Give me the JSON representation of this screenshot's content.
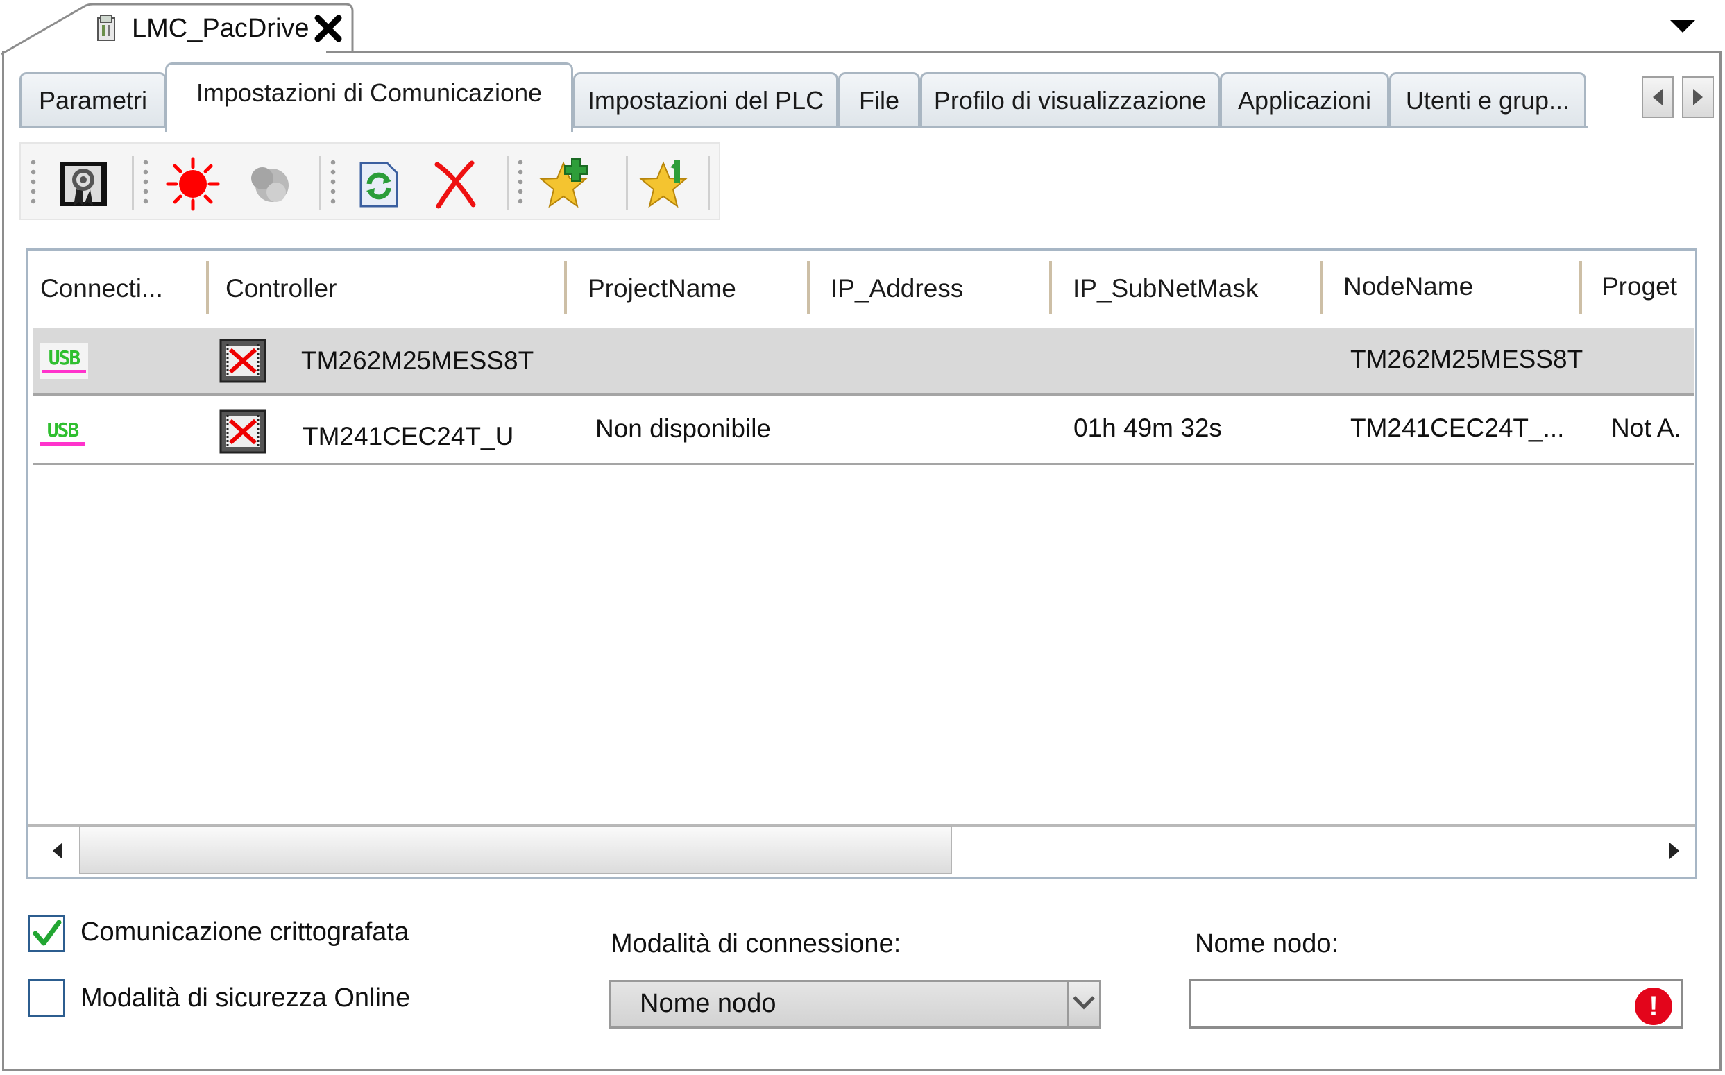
{
  "window": {
    "title": "LMC_PacDrive",
    "icons": {
      "document": "device-document-icon",
      "close": "close-icon",
      "menu": "chevron-down-icon"
    }
  },
  "tabs": [
    {
      "label": "Parametri",
      "active": false
    },
    {
      "label": "Impostazioni di Comunicazione",
      "active": true
    },
    {
      "label": "Impostazioni del PLC",
      "active": false
    },
    {
      "label": "File",
      "active": false
    },
    {
      "label": "Profilo di visualizzazione",
      "active": false
    },
    {
      "label": "Applicazioni",
      "active": false
    },
    {
      "label": "Utenti e grup...",
      "active": false
    }
  ],
  "toolbar": {
    "items": [
      "certificate-icon",
      "flash-led-icon",
      "process-status-icon",
      "refresh-icon",
      "delete-icon",
      "add-favorite-icon",
      "favorite-manage-icon"
    ]
  },
  "table": {
    "columns": [
      "Connecti...",
      "Controller",
      "ProjectName",
      "IP_Address",
      "IP_SubNetMask",
      "NodeName",
      "Proget"
    ],
    "rows": [
      {
        "connection": "USB",
        "controller": "TM262M25MESS8T",
        "project": "",
        "ip": "",
        "subnet": "",
        "node": "TM262M25MESS8T",
        "proget": "",
        "selected": true
      },
      {
        "connection": "USB",
        "controller": "TM241CEC24T_U",
        "project": "Non disponibile",
        "ip": "",
        "subnet": "01h 49m 32s",
        "node": "TM241CEC24T_...",
        "proget": "Not A.",
        "selected": false
      }
    ]
  },
  "options": {
    "encrypted_label": "Comunicazione crittografata",
    "encrypted_checked": true,
    "secure_label": "Modalità di sicurezza Online",
    "secure_checked": false
  },
  "connection_mode": {
    "label": "Modalità di connessione:",
    "value": "Nome nodo"
  },
  "node_name": {
    "label": "Nome nodo:",
    "value": "",
    "error_glyph": "!"
  },
  "colors": {
    "accent_tab_border": "#a9b6c2",
    "selected_row": "#d9d9d9",
    "error": "#e3051b",
    "usb_green": "#2fbf2f",
    "usb_pink": "#ff33cc"
  }
}
